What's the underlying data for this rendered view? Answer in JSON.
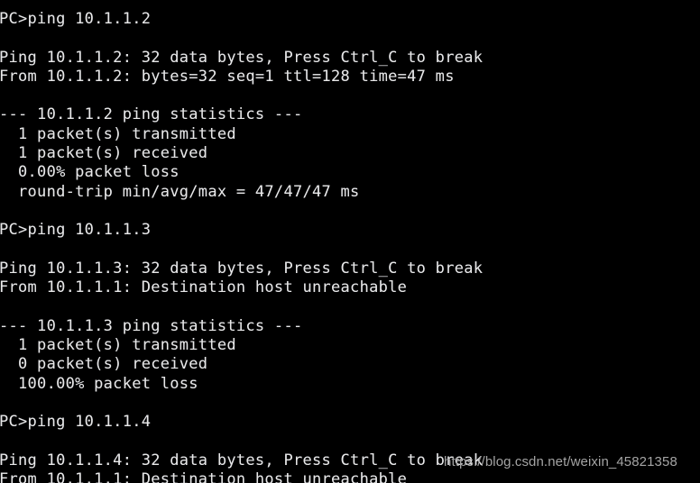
{
  "terminal": {
    "prompt": "PC>",
    "background_color": "#000000",
    "text_color": "#e8e8e8",
    "lines": [
      "PC>ping 10.1.1.2",
      "",
      "Ping 10.1.1.2: 32 data bytes, Press Ctrl_C to break",
      "From 10.1.1.2: bytes=32 seq=1 ttl=128 time=47 ms",
      "",
      "--- 10.1.1.2 ping statistics ---",
      "  1 packet(s) transmitted",
      "  1 packet(s) received",
      "  0.00% packet loss",
      "  round-trip min/avg/max = 47/47/47 ms",
      "",
      "PC>ping 10.1.1.3",
      "",
      "Ping 10.1.1.3: 32 data bytes, Press Ctrl_C to break",
      "From 10.1.1.1: Destination host unreachable",
      "",
      "--- 10.1.1.3 ping statistics ---",
      "  1 packet(s) transmitted",
      "  0 packet(s) received",
      "  100.00% packet loss",
      "",
      "PC>ping 10.1.1.4",
      "",
      "Ping 10.1.1.4: 32 data bytes, Press Ctrl_C to break",
      "From 10.1.1.1: Destination host unreachable"
    ],
    "sessions": [
      {
        "command": "ping 10.1.1.2",
        "target": "10.1.1.2",
        "header": "Ping 10.1.1.2: 32 data bytes, Press Ctrl_C to break",
        "replies": [
          "From 10.1.1.2: bytes=32 seq=1 ttl=128 time=47 ms"
        ],
        "stats_title": "--- 10.1.1.2 ping statistics ---",
        "transmitted": "1 packet(s) transmitted",
        "received": "1 packet(s) received",
        "loss": "0.00% packet loss",
        "round_trip": "round-trip min/avg/max = 47/47/47 ms",
        "result": "success"
      },
      {
        "command": "ping 10.1.1.3",
        "target": "10.1.1.3",
        "header": "Ping 10.1.1.3: 32 data bytes, Press Ctrl_C to break",
        "replies": [
          "From 10.1.1.1: Destination host unreachable"
        ],
        "stats_title": "--- 10.1.1.3 ping statistics ---",
        "transmitted": "1 packet(s) transmitted",
        "received": "0 packet(s) received",
        "loss": "100.00% packet loss",
        "round_trip": "",
        "result": "unreachable"
      },
      {
        "command": "ping 10.1.1.4",
        "target": "10.1.1.4",
        "header": "Ping 10.1.1.4: 32 data bytes, Press Ctrl_C to break",
        "replies": [
          "From 10.1.1.1: Destination host unreachable"
        ],
        "stats_title": "",
        "transmitted": "",
        "received": "",
        "loss": "",
        "round_trip": "",
        "result": "unreachable"
      }
    ]
  },
  "watermark": {
    "text": "https://blog.csdn.net/weixin_45821358",
    "color": "#a4a4a4"
  }
}
